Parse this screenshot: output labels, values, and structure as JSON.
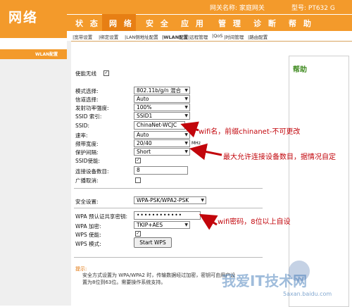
{
  "logo": {
    "text": "网络"
  },
  "topbar": {
    "gateway_name": "网关名称: 家庭网关",
    "model": "型号: PT632 G"
  },
  "nav": {
    "tabs": [
      "状 态",
      "网 络",
      "安 全",
      "应 用",
      "管 理",
      "诊 断",
      "帮 助"
    ],
    "active": "网 络"
  },
  "subnav": {
    "items": [
      "|宽带设置",
      "|绑定设置",
      "|LAN侧地址配置",
      "|WLAN配置",
      "|远程管理",
      "|QoS",
      "|时间管理",
      "|路由配置"
    ],
    "active": "|WLAN配置"
  },
  "side": {
    "label": "WLAN配置"
  },
  "form": {
    "enable_wireless": {
      "label": "使能无线",
      "checked": true
    },
    "mode": {
      "label": "模式选择:",
      "value": "802.11b/g/n 混合"
    },
    "channel": {
      "label": "信道选择:",
      "value": "Auto"
    },
    "power": {
      "label": "发射功率强度:",
      "value": "100%"
    },
    "ssid_index": {
      "label": "SSID 索引:",
      "value": "SSID1"
    },
    "ssid": {
      "label": "SSID:",
      "value": "ChinaNet-WCJC"
    },
    "rate": {
      "label": "速率:",
      "value": "Auto"
    },
    "bandwidth": {
      "label": "频带宽度:",
      "value": "20/40",
      "unit": "MHz"
    },
    "guard": {
      "label": "保护间隔:",
      "value": "Short"
    },
    "ssid_enable": {
      "label": "SSID使能:",
      "checked": true
    },
    "max_clients": {
      "label": "连接设备数目:",
      "value": "8"
    },
    "broadcast_cancel": {
      "label": "广播取消:",
      "checked": false
    },
    "security": {
      "label": "安全设置:",
      "value": "WPA-PSK/WPA2-PSK"
    },
    "wpa_key": {
      "label": "WPA 预认证共享密钥:",
      "value": "••••••••••••"
    },
    "wpa_encrypt": {
      "label": "WPA 加密:",
      "value": "TKIP+AES"
    },
    "wps_enable": {
      "label": "WPS 使能:",
      "checked": true
    },
    "wps_mode": {
      "label": "WPS 模式:",
      "button": "Start WPS"
    }
  },
  "annotations": {
    "ssid_note": "wifi名，前缀chinanet-不可更改",
    "clients_note": "最大允许连接设备数目，据情况自定",
    "password_note": "wifi密码，8位以上自设"
  },
  "help": {
    "title": "帮助"
  },
  "tips": {
    "title": "提示:",
    "text": "安全方式设置为 WPA/WPA2 时，传输数据经过加密，密钥可由用户设置为8位到63位。需要操作系统支持。"
  },
  "watermark": {
    "text": "我爱IT技术网",
    "sub": "5axan.baidu.com"
  }
}
